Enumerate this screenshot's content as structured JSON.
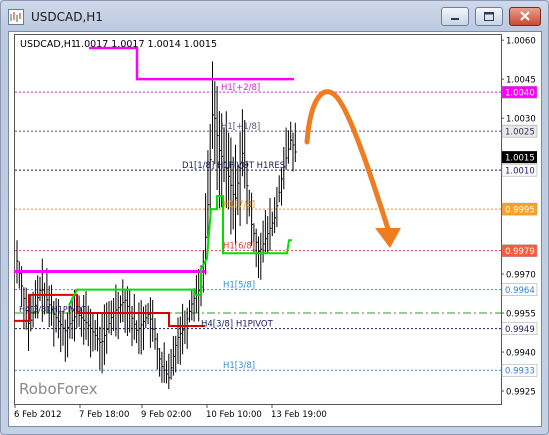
{
  "window": {
    "title": "USDCAD,H1",
    "buttons": {
      "minimize": "minimize",
      "maximize": "maximize",
      "close": "close"
    }
  },
  "chart_header": {
    "symbol": "USDCAD,H1",
    "ohlc": "1.0017 1.0017 1.0014 1.0015"
  },
  "watermark": "RoboForex",
  "colors": {
    "bars": "#000000",
    "green_trail": "#00e000",
    "magenta": "#ff00ff",
    "red_trail": "#dd0000",
    "arrow": "#f07c22",
    "current_price_badge": "#000000"
  },
  "chart_data": {
    "type": "candlestick-hlc",
    "symbol": "USDCAD",
    "timeframe": "H1",
    "ylim": [
      0.992,
      1.0062
    ],
    "price_axis_ticks": [
      "1.0060",
      "1.0045",
      "1.0030",
      "1.0010",
      "0.9995",
      "0.9979",
      "0.9970",
      "0.9955",
      "0.9940",
      "0.9925"
    ],
    "time_axis_labels": [
      "6 Feb 2012",
      "7 Feb 18:00",
      "9 Feb 02:00",
      "10 Feb 10:00",
      "13 Feb 19:00"
    ],
    "current_price": "1.0015",
    "levels": [
      {
        "label": "H1[+2/8]",
        "price": "1.0040",
        "color": "#e020e0",
        "badge_bg": "#ff00ff",
        "badge_fg": "#ffffff"
      },
      {
        "label": "H1[+1/8]",
        "price": "1.0025",
        "color": "#505080",
        "badge_bg": "#e8e8e8",
        "badge_fg": "#333355"
      },
      {
        "label": "D1[1/8] H1PIVOT H1RES",
        "price": "1.0010",
        "color": "#1a1a60",
        "badge_bg": "#ffffff",
        "badge_fg": "#1a1a60"
      },
      {
        "label": "H1[7/8]",
        "price": "0.9995",
        "color": "#f09020",
        "badge_bg": "#ffa020",
        "badge_fg": "#ffffff"
      },
      {
        "label": "H1[6/8]",
        "price": "0.9979",
        "color": "#e04040",
        "badge_bg": "#ff5a3a",
        "badge_fg": "#ffffff"
      },
      {
        "label": "H1[5/8]",
        "price": "0.9964",
        "color": "#3090e0",
        "badge_bg": "#ffffff",
        "badge_fg": "#3080d0"
      },
      {
        "label": "H4[3/8] H1PIVOT",
        "price": "0.9949",
        "color": "#1a1a60",
        "badge_bg": "#ffffff",
        "badge_fg": "#1a1a60"
      },
      {
        "label": "H1[3/8]",
        "price": "0.9933",
        "color": "#3090e0",
        "badge_bg": "#ffffff",
        "badge_fg": "#3080d0"
      }
    ],
    "green_dash_dot_price": 0.9955,
    "left_level_label": "H4[3/8] H1PIVOT",
    "forecast": "arrow from ~1.0025 arching up to ~1.0045 then down to ~0.9980"
  }
}
